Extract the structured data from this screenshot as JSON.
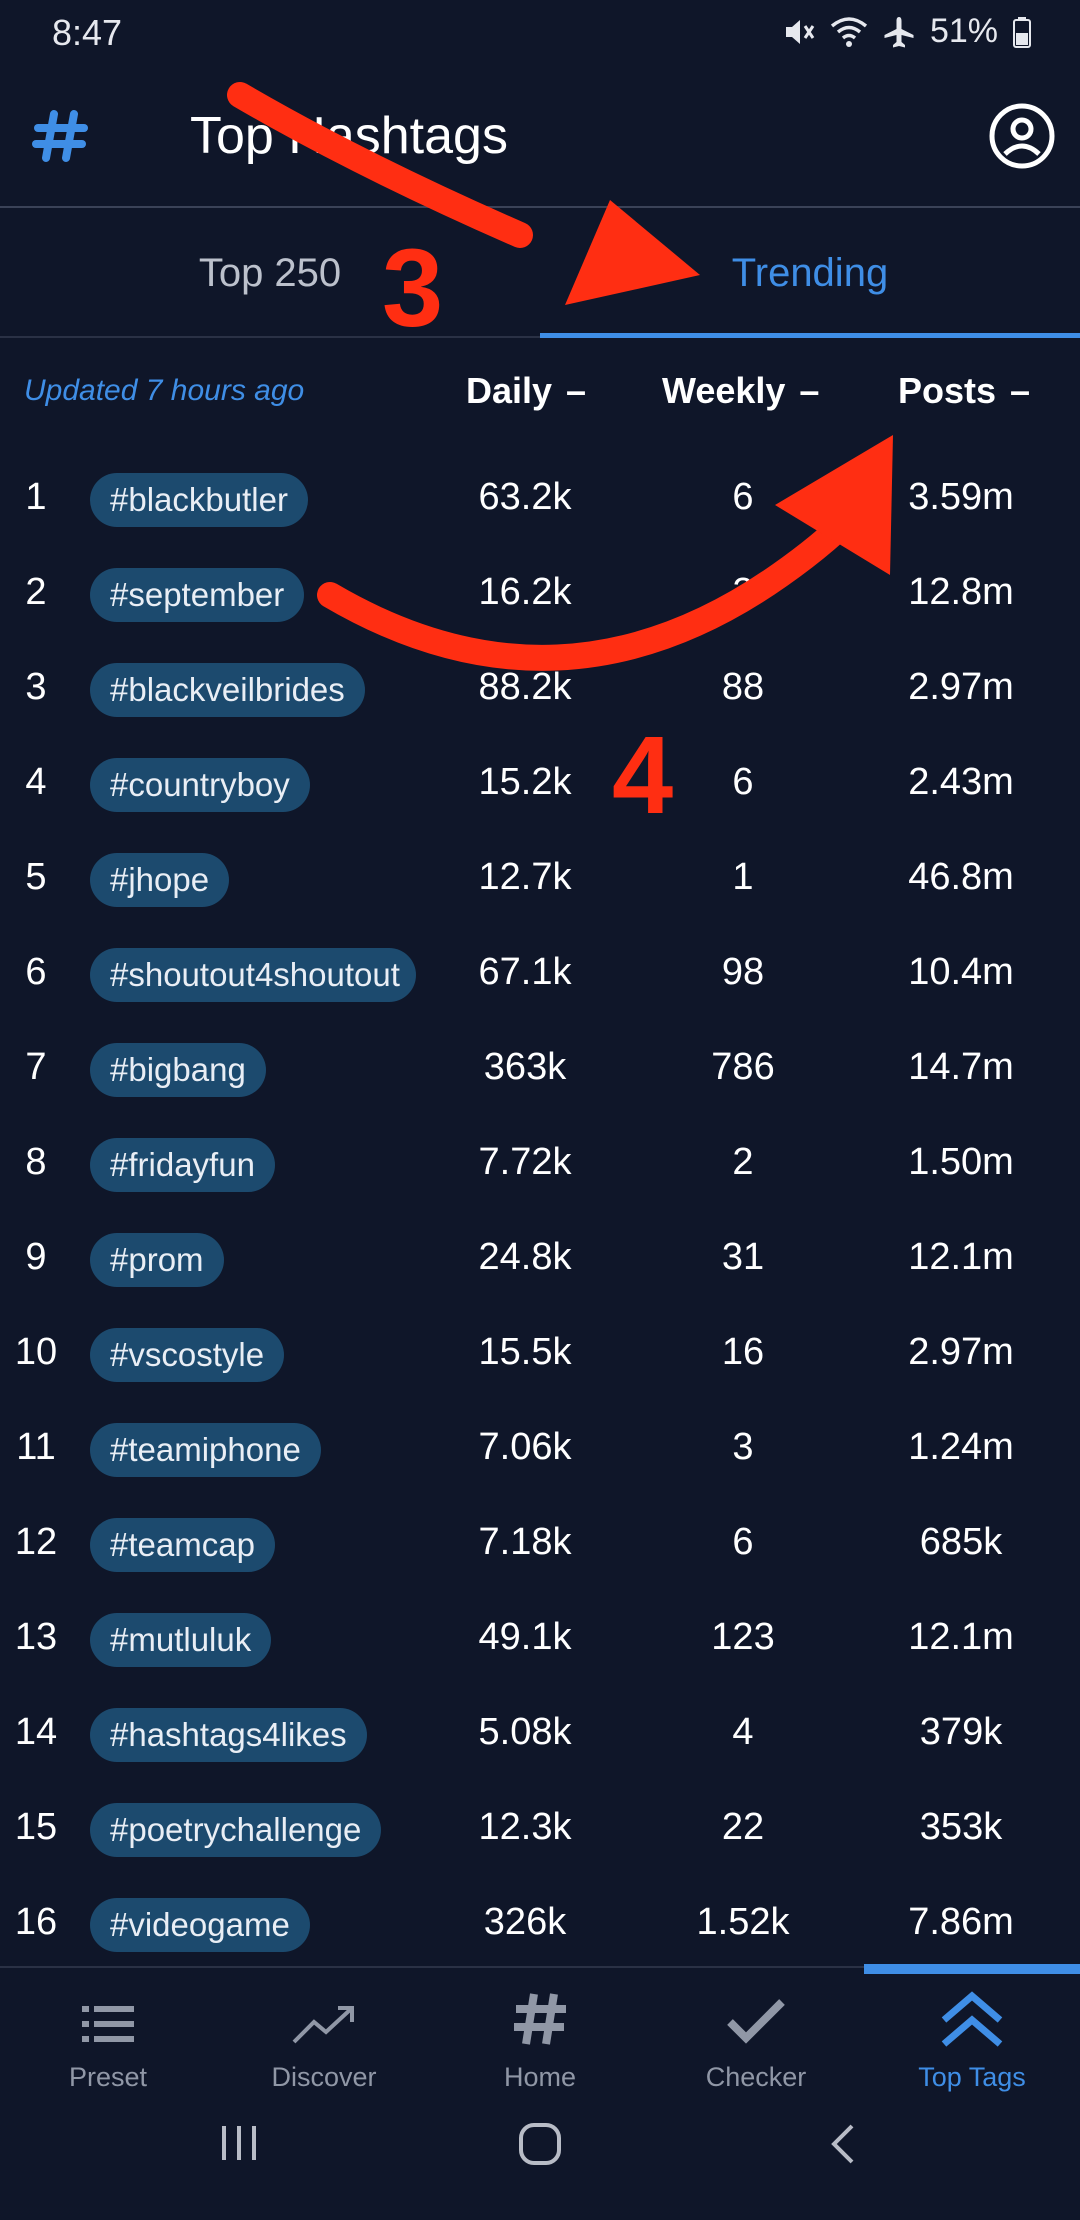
{
  "status": {
    "time": "8:47",
    "battery": "51%"
  },
  "app": {
    "title": "Top Hashtags"
  },
  "tabs": [
    {
      "label": "Top 250"
    },
    {
      "label": "Trending"
    }
  ],
  "header": {
    "updated": "Updated 7 hours ago",
    "daily": "Daily",
    "weekly": "Weekly",
    "posts": "Posts",
    "sort_dash": "–"
  },
  "rows": [
    {
      "rank": "1",
      "tag": "#blackbutler",
      "daily": "63.2k",
      "weekly": "6",
      "posts": "3.59m"
    },
    {
      "rank": "2",
      "tag": "#september",
      "daily": "16.2k",
      "weekly": "2",
      "posts": "12.8m"
    },
    {
      "rank": "3",
      "tag": "#blackveilbrides",
      "daily": "88.2k",
      "weekly": "88",
      "posts": "2.97m"
    },
    {
      "rank": "4",
      "tag": "#countryboy",
      "daily": "15.2k",
      "weekly": "6",
      "posts": "2.43m"
    },
    {
      "rank": "5",
      "tag": "#jhope",
      "daily": "12.7k",
      "weekly": "1",
      "posts": "46.8m"
    },
    {
      "rank": "6",
      "tag": "#shoutout4shoutout",
      "daily": "67.1k",
      "weekly": "98",
      "posts": "10.4m"
    },
    {
      "rank": "7",
      "tag": "#bigbang",
      "daily": "363k",
      "weekly": "786",
      "posts": "14.7m"
    },
    {
      "rank": "8",
      "tag": "#fridayfun",
      "daily": "7.72k",
      "weekly": "2",
      "posts": "1.50m"
    },
    {
      "rank": "9",
      "tag": "#prom",
      "daily": "24.8k",
      "weekly": "31",
      "posts": "12.1m"
    },
    {
      "rank": "10",
      "tag": "#vscostyle",
      "daily": "15.5k",
      "weekly": "16",
      "posts": "2.97m"
    },
    {
      "rank": "11",
      "tag": "#teamiphone",
      "daily": "7.06k",
      "weekly": "3",
      "posts": "1.24m"
    },
    {
      "rank": "12",
      "tag": "#teamcap",
      "daily": "7.18k",
      "weekly": "6",
      "posts": "685k"
    },
    {
      "rank": "13",
      "tag": "#mutluluk",
      "daily": "49.1k",
      "weekly": "123",
      "posts": "12.1m"
    },
    {
      "rank": "14",
      "tag": "#hashtags4likes",
      "daily": "5.08k",
      "weekly": "4",
      "posts": "379k"
    },
    {
      "rank": "15",
      "tag": "#poetrychallenge",
      "daily": "12.3k",
      "weekly": "22",
      "posts": "353k"
    },
    {
      "rank": "16",
      "tag": "#videogame",
      "daily": "326k",
      "weekly": "1.52k",
      "posts": "7.86m"
    }
  ],
  "nav": [
    {
      "label": "Preset",
      "icon": "list-icon"
    },
    {
      "label": "Discover",
      "icon": "trending-up-icon"
    },
    {
      "label": "Home",
      "icon": "hashtag-icon"
    },
    {
      "label": "Checker",
      "icon": "check-icon"
    },
    {
      "label": "Top Tags",
      "icon": "chevrons-up-icon",
      "active": true
    }
  ],
  "annotations": {
    "step3": "3",
    "step4": "4",
    "color": "#ff2e12"
  },
  "colors": {
    "background": "#0f1629",
    "accent": "#3f8ee6",
    "chip": "#1c4a6e"
  }
}
